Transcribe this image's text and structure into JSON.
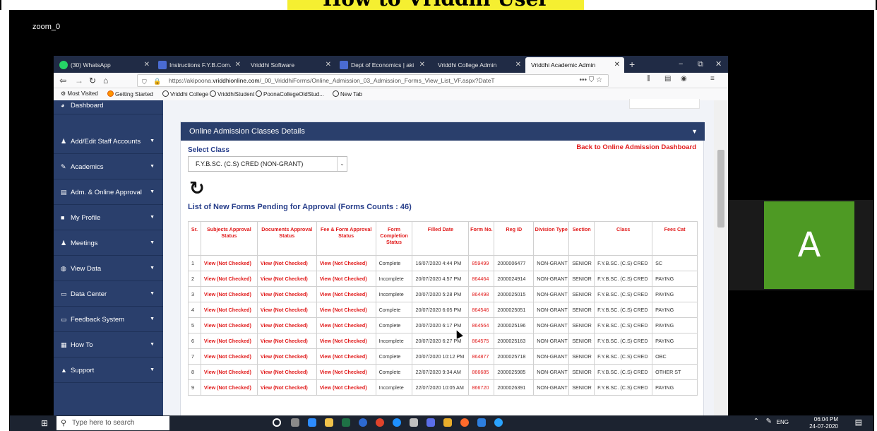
{
  "banner": "How to Vriddhi User",
  "zoom": {
    "label": "zoom_0",
    "participant_initial": "A",
    "participant_color": "#4e9a24"
  },
  "browser": {
    "tabs": [
      {
        "label": "(30) WhatsApp",
        "icon": "whatsapp-icon",
        "color": "#25d366"
      },
      {
        "label": "Instructions F.Y.B.Com.",
        "icon": "site-icon",
        "color": "#4a6bd2"
      },
      {
        "label": "Vriddhi Software",
        "icon": "none",
        "color": ""
      },
      {
        "label": "Dept of Economics | aki",
        "icon": "site-icon",
        "color": "#4a6bd2"
      },
      {
        "label": "Vriddhi College Admin",
        "icon": "none",
        "color": ""
      },
      {
        "label": "Vriddhi Academic Admin",
        "icon": "none",
        "color": ""
      }
    ],
    "url_prefix": "https://akipoona.",
    "url_domain": "vriddhionline.com",
    "url_path": "/_00_VriddhiForms/Online_Admission_03_Admission_Forms_View_List_VF.aspx?DateT",
    "url_actions": "••• ⛉ ☆",
    "bookmarks": [
      "Most Visited",
      "Getting Started",
      "Vriddhi College",
      "VriddhiStudent",
      "PoonaCollegeOldStud...",
      "New Tab"
    ]
  },
  "sidebar": {
    "items": [
      {
        "label": "Dashboard",
        "icon": "dashboard-icon"
      },
      {
        "label": "Add/Edit Staff Accounts",
        "icon": "user-icon"
      },
      {
        "label": "Academics",
        "icon": "edit-icon"
      },
      {
        "label": "Adm. & Online Approval",
        "icon": "list-icon"
      },
      {
        "label": "My Profile",
        "icon": "profile-icon"
      },
      {
        "label": "Meetings",
        "icon": "users-icon"
      },
      {
        "label": "View Data",
        "icon": "eye-icon"
      },
      {
        "label": "Data Center",
        "icon": "monitor-icon"
      },
      {
        "label": "Feedback System",
        "icon": "monitor-icon"
      },
      {
        "label": "How To",
        "icon": "grid-icon"
      },
      {
        "label": "Support",
        "icon": "lock-icon"
      }
    ]
  },
  "panel": {
    "title": "Online Admission Classes Details",
    "select_label": "Select Class",
    "back_link": "Back to Online Admission Dashboard",
    "selected_class": "F.Y.B.SC. (C.S) CRED (NON-GRANT)",
    "list_title": "List of New Forms Pending for Approval (Forms Counts : 46)"
  },
  "table": {
    "headers": [
      "Sr.",
      "Subjects Approval Status",
      "Documents Approval Status",
      "Fee & Form Approval Status",
      "Form Completion Status",
      "Filled Date",
      "Form No.",
      "Reg ID",
      "Division Type",
      "Section",
      "Class",
      "Fees Cat"
    ],
    "rows": [
      [
        "1",
        "View (Not Checked)",
        "View (Not Checked)",
        "View (Not Checked)",
        "Complete",
        "16/07/2020 4:44 PM",
        "859499",
        "2000006477",
        "NON-GRANT",
        "SENIOR",
        "F.Y.B.SC. (C.S) CRED",
        "SC"
      ],
      [
        "2",
        "View (Not Checked)",
        "View (Not Checked)",
        "View (Not Checked)",
        "Incomplete",
        "20/07/2020 4:57 PM",
        "864464",
        "2000024914",
        "NON-GRANT",
        "SENIOR",
        "F.Y.B.SC. (C.S) CRED",
        "PAYING"
      ],
      [
        "3",
        "View (Not Checked)",
        "View (Not Checked)",
        "View (Not Checked)",
        "Incomplete",
        "20/07/2020 5:28 PM",
        "864498",
        "2000025015",
        "NON-GRANT",
        "SENIOR",
        "F.Y.B.SC. (C.S) CRED",
        "PAYING"
      ],
      [
        "4",
        "View (Not Checked)",
        "View (Not Checked)",
        "View (Not Checked)",
        "Complete",
        "20/07/2020 6:05 PM",
        "864546",
        "2000025051",
        "NON-GRANT",
        "SENIOR",
        "F.Y.B.SC. (C.S) CRED",
        "PAYING"
      ],
      [
        "5",
        "View (Not Checked)",
        "View (Not Checked)",
        "View (Not Checked)",
        "Complete",
        "20/07/2020 6:17 PM",
        "864564",
        "2000025196",
        "NON-GRANT",
        "SENIOR",
        "F.Y.B.SC. (C.S) CRED",
        "PAYING"
      ],
      [
        "6",
        "View (Not Checked)",
        "View (Not Checked)",
        "View (Not Checked)",
        "Incomplete",
        "20/07/2020 6:27 PM",
        "864575",
        "2000025163",
        "NON-GRANT",
        "SENIOR",
        "F.Y.B.SC. (C.S) CRED",
        "PAYING"
      ],
      [
        "7",
        "View (Not Checked)",
        "View (Not Checked)",
        "View (Not Checked)",
        "Complete",
        "20/07/2020 10:12 PM",
        "864877",
        "2000025718",
        "NON-GRANT",
        "SENIOR",
        "F.Y.B.SC. (C.S) CRED",
        "OBC"
      ],
      [
        "8",
        "View (Not Checked)",
        "View (Not Checked)",
        "View (Not Checked)",
        "Complete",
        "22/07/2020 9:34 AM",
        "866685",
        "2000025985",
        "NON-GRANT",
        "SENIOR",
        "F.Y.B.SC. (C.S) CRED",
        "OTHER ST"
      ],
      [
        "9",
        "View (Not Checked)",
        "View (Not Checked)",
        "View (Not Checked)",
        "Incomplete",
        "22/07/2020 10:05 AM",
        "866720",
        "2000026391",
        "NON-GRANT",
        "SENIOR",
        "F.Y.B.SC. (C.S) CRED",
        "PAYING"
      ]
    ]
  },
  "taskbar": {
    "search_placeholder": "Type here to search",
    "lang": "ENG",
    "time": "06:04 PM",
    "date": "24-07-2020"
  },
  "colors": {
    "sidebar": "#2a3f6c",
    "accent_red": "#e11a1a",
    "title_blue": "#263d8a",
    "banner": "#f5ef31"
  }
}
